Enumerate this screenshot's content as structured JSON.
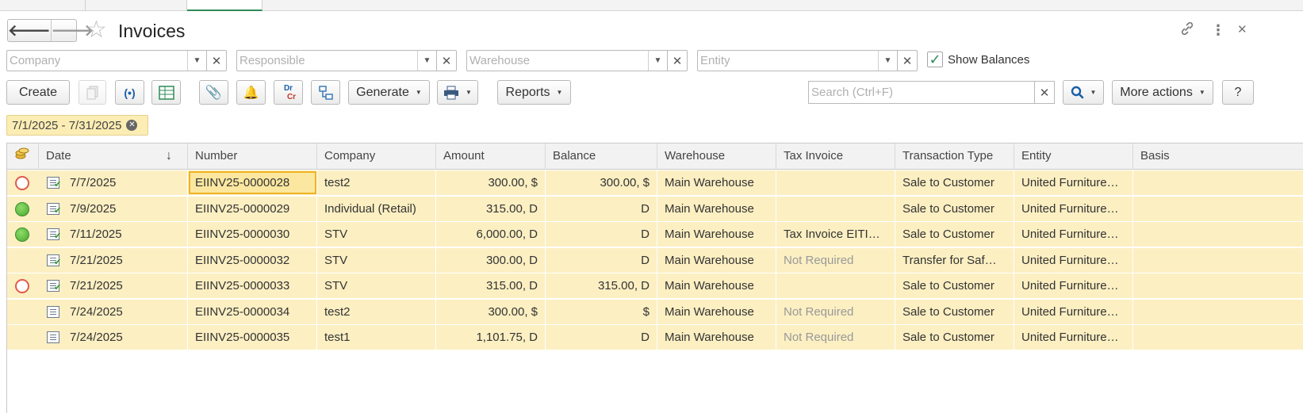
{
  "window": {
    "title": "Invoices",
    "nav_back": "🡐",
    "nav_forward": "🡒",
    "favorite_icon": "☆",
    "link_icon": "🔗",
    "more_icon": "⋮",
    "close_icon": "✕"
  },
  "filters": {
    "company_placeholder": "Company",
    "responsible_placeholder": "Responsible",
    "warehouse_placeholder": "Warehouse",
    "entity_placeholder": "Entity",
    "show_balances_label": "Show Balances",
    "show_balances_checked": true,
    "dropdown_icon": "▼",
    "clear_icon": "✕"
  },
  "toolbar": {
    "create_label": "Create",
    "generate_label": "Generate",
    "reports_label": "Reports",
    "search_placeholder": "Search (Ctrl+F)",
    "more_actions_label": "More actions",
    "help_label": "?",
    "caret": "▼",
    "search_clear": "✕",
    "icons": [
      "copy-icon",
      "post-icon",
      "journal-icon",
      "attach-icon",
      "reminder-icon",
      "debit-credit-icon",
      "structure-icon",
      "print-icon",
      "find-icon"
    ],
    "dr_label": "Dr",
    "cr_label": "Cr"
  },
  "period_chip": {
    "label": "7/1/2025 - 7/31/2025",
    "clear_icon": "✕"
  },
  "table": {
    "sort_arrow": "↓",
    "columns": [
      "Date",
      "Number",
      "Company",
      "Amount",
      "Balance",
      "Warehouse",
      "Tax Invoice",
      "Transaction Type",
      "Entity",
      "Basis"
    ],
    "rows": [
      {
        "status": "open",
        "posted": true,
        "date": "7/7/2025",
        "number": "EIINV25-0000028",
        "company": "test2",
        "amount": "300.00, $",
        "balance": "300.00, $",
        "warehouse": "Main Warehouse",
        "tax_invoice": "",
        "transaction_type": "Sale to Customer",
        "entity": "United Furniture…",
        "basis": ""
      },
      {
        "status": "paid",
        "posted": true,
        "date": "7/9/2025",
        "number": "EIINV25-0000029",
        "company": "Individual (Retail)",
        "amount": "315.00, D",
        "balance": "D",
        "warehouse": "Main Warehouse",
        "tax_invoice": "",
        "transaction_type": "Sale to Customer",
        "entity": "United Furniture…",
        "basis": ""
      },
      {
        "status": "paid",
        "posted": true,
        "date": "7/11/2025",
        "number": "EIINV25-0000030",
        "company": "STV",
        "amount": "6,000.00, D",
        "balance": "D",
        "warehouse": "Main Warehouse",
        "tax_invoice": "Tax Invoice EITI…",
        "transaction_type": "Sale to Customer",
        "entity": "United Furniture…",
        "basis": ""
      },
      {
        "status": "none",
        "posted": true,
        "date": "7/21/2025",
        "number": "EIINV25-0000032",
        "company": "STV",
        "amount": "300.00, D",
        "balance": "D",
        "warehouse": "Main Warehouse",
        "tax_invoice": "Not Required",
        "transaction_type": "Transfer for Saf…",
        "entity": "United Furniture…",
        "basis": ""
      },
      {
        "status": "open",
        "posted": true,
        "date": "7/21/2025",
        "number": "EIINV25-0000033",
        "company": "STV",
        "amount": "315.00, D",
        "balance": "315.00, D",
        "warehouse": "Main Warehouse",
        "tax_invoice": "",
        "transaction_type": "Sale to Customer",
        "entity": "United Furniture…",
        "basis": ""
      },
      {
        "status": "none",
        "posted": false,
        "date": "7/24/2025",
        "number": "EIINV25-0000034",
        "company": "test2",
        "amount": "300.00, $",
        "balance": "$",
        "warehouse": "Main Warehouse",
        "tax_invoice": "Not Required",
        "transaction_type": "Sale to Customer",
        "entity": "United Furniture…",
        "basis": ""
      },
      {
        "status": "none",
        "posted": false,
        "date": "7/24/2025",
        "number": "EIINV25-0000035",
        "company": "test1",
        "amount": "1,101.75, D",
        "balance": "D",
        "warehouse": "Main Warehouse",
        "tax_invoice": "Not Required",
        "transaction_type": "Sale to Customer",
        "entity": "United Furniture…",
        "basis": ""
      }
    ]
  },
  "colors": {
    "row_bg": "#fcefc2",
    "selected_border": "#f0b323",
    "open_status": "#e15b4a",
    "paid_status": "#46a82d",
    "accent": "#2e8b57"
  }
}
